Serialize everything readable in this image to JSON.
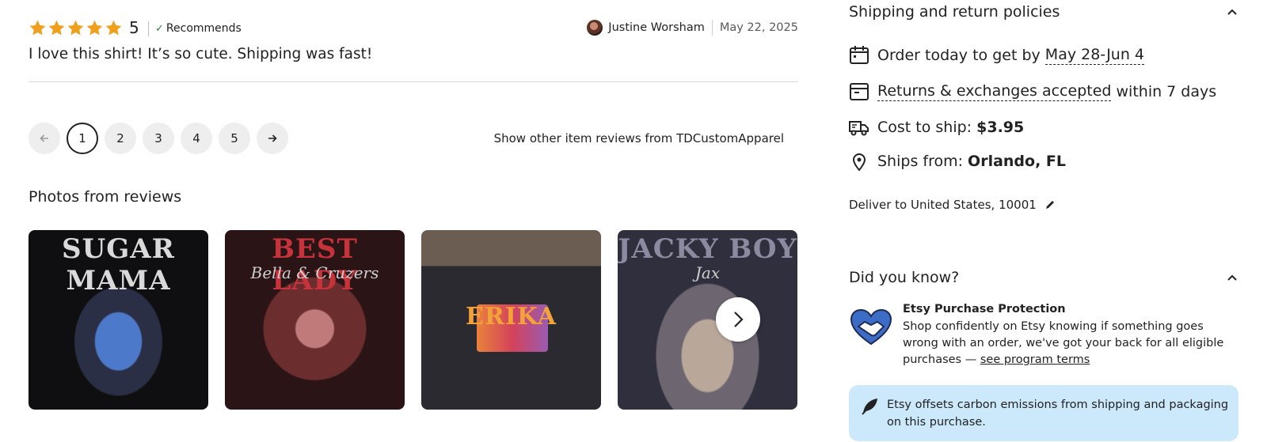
{
  "review": {
    "rating": "5",
    "stars": 5,
    "recommends_label": "Recommends",
    "reviewer_name": "Justine Worsham",
    "date": "May 22, 2025",
    "text": "I love this shirt! It’s so cute. Shipping was fast!"
  },
  "pagination": {
    "prev_icon": "arrow-left-icon",
    "next_icon": "arrow-right-icon",
    "pages": [
      "1",
      "2",
      "3",
      "4",
      "5"
    ],
    "current_page": "1"
  },
  "show_other_label": "Show other item reviews from TDCustomApparel",
  "photos": {
    "title": "Photos from reviews",
    "items": [
      {
        "overlay_text": "SUGAR MAMA",
        "overlay_sub": ""
      },
      {
        "overlay_text": "BEST LADY",
        "overlay_sub": "Bella & Cruzers"
      },
      {
        "overlay_text": "ERIKA",
        "overlay_sub": ""
      },
      {
        "overlay_text": "JACKY BOY",
        "overlay_sub": "Jax"
      }
    ],
    "next_icon": "chevron-right-icon"
  },
  "shipping": {
    "title": "Shipping and return policies",
    "order_prefix": "Order today to get by ",
    "order_dates": "May 28-Jun 4",
    "returns_link": "Returns & exchanges accepted",
    "returns_suffix": " within 7 days",
    "cost_label": "Cost to ship: ",
    "cost_value": "$3.95",
    "ships_from_label": "Ships from: ",
    "ships_from_value": "Orlando, FL",
    "deliver_to": "Deliver to United States, 10001"
  },
  "did_you_know": {
    "title": "Did you know?",
    "protection_title": "Etsy Purchase Protection",
    "protection_body": "Shop confidently on Etsy knowing if something goes wrong with an order, we've got your back for all eligible purchases — ",
    "protection_link": "see program terms",
    "carbon_text": "Etsy offsets carbon emissions from shipping and packaging on this purchase."
  },
  "colors": {
    "star": "#f1a01e",
    "check": "#258635",
    "carbon_bg": "#cce8fb",
    "handshake_blue": "#3d6cc6"
  }
}
